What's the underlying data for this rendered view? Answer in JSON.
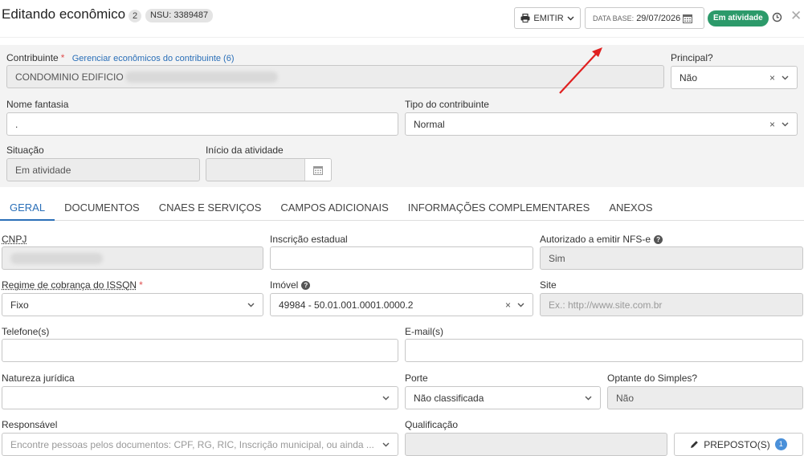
{
  "header": {
    "title": "Editando econômico",
    "count": "2",
    "nsu": "NSU: 3389487",
    "emitir_label": "EMITIR",
    "data_base_label": "DATA BASE:",
    "data_base_value": "29/07/2026",
    "status_badge": "Em atividade"
  },
  "top": {
    "contribuinte_label": "Contribuinte",
    "contribuinte_required": "*",
    "gerenciar_link": "Gerenciar econômicos do contribuinte (6)",
    "contribuinte_value": "CONDOMINIO EDIFICIO",
    "principal_label": "Principal?",
    "principal_value": "Não",
    "nome_fantasia_label": "Nome fantasia",
    "nome_fantasia_value": ".",
    "tipo_label": "Tipo do contribuinte",
    "tipo_value": "Normal",
    "situacao_label": "Situação",
    "situacao_value": "Em atividade",
    "inicio_label": "Início da atividade",
    "inicio_value": ""
  },
  "tabs": [
    {
      "label": "GERAL"
    },
    {
      "label": "DOCUMENTOS"
    },
    {
      "label": "CNAES E SERVIÇOS"
    },
    {
      "label": "CAMPOS ADICIONAIS"
    },
    {
      "label": "INFORMAÇÕES COMPLEMENTARES"
    },
    {
      "label": "ANEXOS"
    }
  ],
  "geral": {
    "cnpj_label": "CNPJ",
    "ie_label": "Inscrição estadual",
    "ie_value": "",
    "nfse_label": "Autorizado a emitir NFS-e",
    "nfse_value": "Sim",
    "regime_label": "Regime de cobrança do ISSQN",
    "regime_required": "*",
    "regime_value": "Fixo",
    "imovel_label": "Imóvel",
    "imovel_value": "49984 - 50.01.001.0001.0000.2",
    "site_label": "Site",
    "site_placeholder": "Ex.: http://www.site.com.br",
    "telefone_label": "Telefone(s)",
    "telefone_value": "",
    "email_label": "E-mail(s)",
    "email_value": "",
    "natureza_label": "Natureza jurídica",
    "natureza_value": "",
    "porte_label": "Porte",
    "porte_value": "Não classificada",
    "simples_label": "Optante do Simples?",
    "simples_value": "Não",
    "responsavel_label": "Responsável",
    "responsavel_placeholder": "Encontre pessoas pelos documentos: CPF, RG, RIC, Inscrição municipal, ou ainda ...",
    "qualificacao_label": "Qualificação",
    "preposto_label": "PREPOSTO(S)",
    "preposto_count": "1"
  },
  "colors": {
    "accent": "#2a6fb8",
    "status_green": "#2c9a6a",
    "required": "#e05050",
    "annotation_arrow": "#e02020"
  },
  "icons": [
    "printer-icon",
    "chevron-down-icon",
    "calendar-icon",
    "history-icon",
    "close-icon",
    "clear-icon",
    "help-icon",
    "pencil-icon"
  ]
}
